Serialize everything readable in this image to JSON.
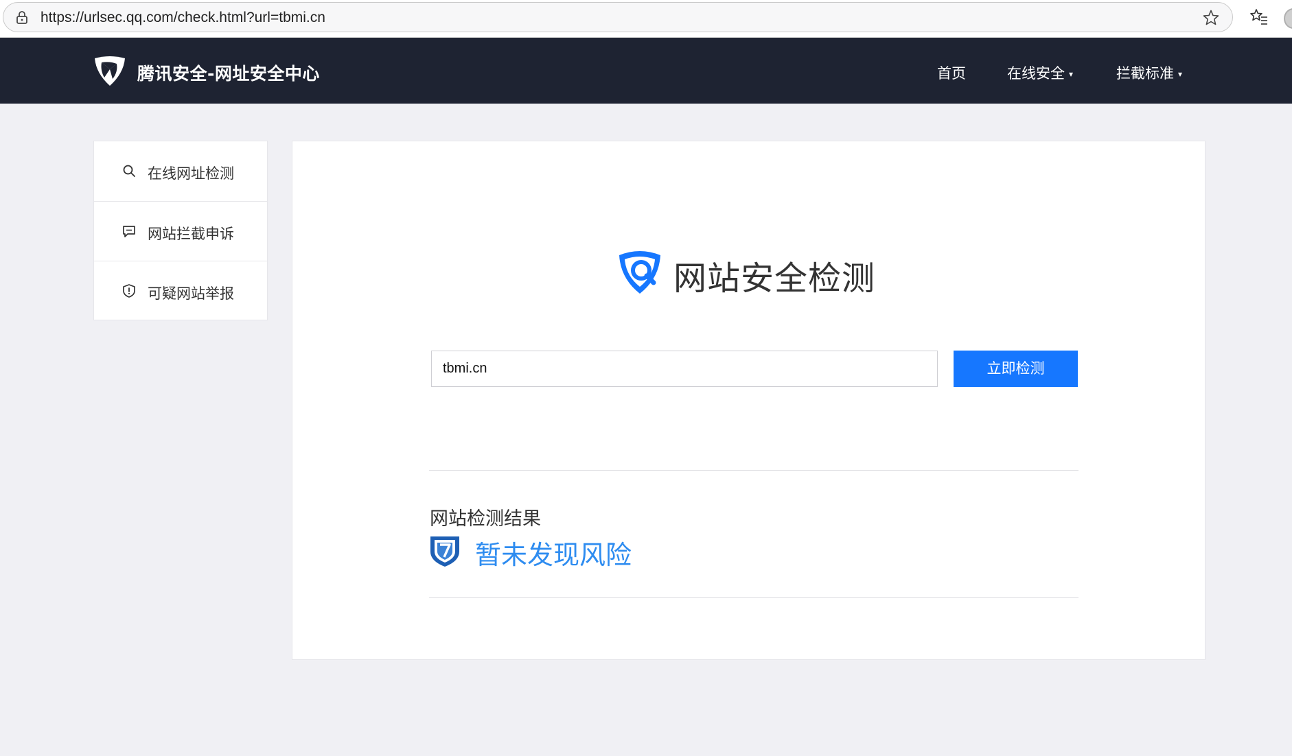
{
  "browser": {
    "url": "https://urlsec.qq.com/check.html?url=tbmi.cn"
  },
  "header": {
    "logo_text": "腾讯安全-网址安全中心",
    "nav": [
      {
        "label": "首页"
      },
      {
        "label": "在线安全",
        "caret": "▾"
      },
      {
        "label": "拦截标准",
        "caret": "▾"
      }
    ]
  },
  "sidebar": {
    "items": [
      {
        "label": "在线网址检测",
        "icon": "search-icon"
      },
      {
        "label": "网站拦截申诉",
        "icon": "chat-icon"
      },
      {
        "label": "可疑网站举报",
        "icon": "shield-alert-icon"
      }
    ]
  },
  "main": {
    "title": "网站安全检测",
    "input_value": "tbmi.cn",
    "button_label": "立即检测",
    "result_label": "网站检测结果",
    "result_text": "暂未发现风险"
  },
  "colors": {
    "header_bg": "#1e2332",
    "accent": "#1677ff",
    "result_text": "#2e8cf0"
  }
}
